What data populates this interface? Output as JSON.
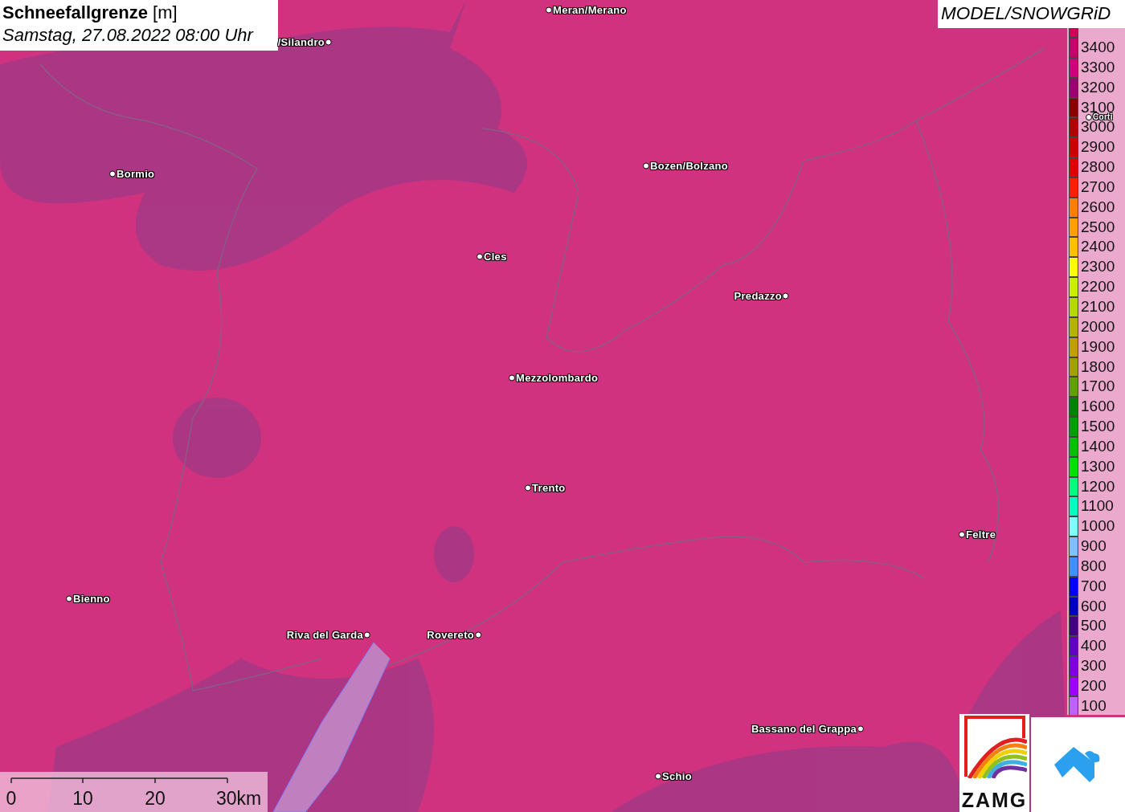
{
  "title": {
    "heading": "**Schneefallgrenze** [m]",
    "time": "Samstag, 27.08.2022 08:00 Uhr"
  },
  "source": "MODEL/SNOWGRiD",
  "cities": [
    {
      "name": "Meran/Merano"
    },
    {
      "name": "/Silandro"
    },
    {
      "name": "Bormio"
    },
    {
      "name": "Bozen/Bolzano"
    },
    {
      "name": "Cles"
    },
    {
      "name": "Predazzo"
    },
    {
      "name": "Mezzolombardo"
    },
    {
      "name": "Trento"
    },
    {
      "name": "Feltre"
    },
    {
      "name": "Bienno"
    },
    {
      "name": "Riva del Garda"
    },
    {
      "name": "Rovereto"
    },
    {
      "name": "Bassano del Grappa"
    },
    {
      "name": "Schio"
    },
    {
      "name": "Corti"
    }
  ],
  "legend": [
    {
      "label": "3400",
      "color": "#c8006e"
    },
    {
      "label": "3300",
      "color": "#d0007c"
    },
    {
      "label": "3200",
      "color": "#9a0070"
    },
    {
      "label": "3100",
      "color": "#8b0000"
    },
    {
      "label": "3000",
      "color": "#b00000"
    },
    {
      "label": "2900",
      "color": "#cc0000"
    },
    {
      "label": "2800",
      "color": "#e00000"
    },
    {
      "label": "2700",
      "color": "#ff2000"
    },
    {
      "label": "2600",
      "color": "#ff8000"
    },
    {
      "label": "2500",
      "color": "#ffa000"
    },
    {
      "label": "2400",
      "color": "#ffc000"
    },
    {
      "label": "2300",
      "color": "#ffff00"
    },
    {
      "label": "2200",
      "color": "#c8f000"
    },
    {
      "label": "2100",
      "color": "#b4d800"
    },
    {
      "label": "2000",
      "color": "#b4b400"
    },
    {
      "label": "1900",
      "color": "#c0a000"
    },
    {
      "label": "1800",
      "color": "#a0a000"
    },
    {
      "label": "1700",
      "color": "#60a000"
    },
    {
      "label": "1600",
      "color": "#008000"
    },
    {
      "label": "1500",
      "color": "#00a000"
    },
    {
      "label": "1400",
      "color": "#00c000"
    },
    {
      "label": "1300",
      "color": "#00e000"
    },
    {
      "label": "1200",
      "color": "#00ff80"
    },
    {
      "label": "1100",
      "color": "#00ffc0"
    },
    {
      "label": "1000",
      "color": "#80ffff"
    },
    {
      "label": "900",
      "color": "#80c0ff"
    },
    {
      "label": "800",
      "color": "#4090ff"
    },
    {
      "label": "700",
      "color": "#0000ff"
    },
    {
      "label": "600",
      "color": "#0000c0"
    },
    {
      "label": "500",
      "color": "#400080"
    },
    {
      "label": "400",
      "color": "#6000c0"
    },
    {
      "label": "300",
      "color": "#8000e0"
    },
    {
      "label": "200",
      "color": "#a000ff"
    },
    {
      "label": "100",
      "color": "#c060ff"
    }
  ],
  "scale": [
    "0",
    "10",
    "20",
    "30km"
  ],
  "logo": {
    "text": "ZAMG"
  }
}
